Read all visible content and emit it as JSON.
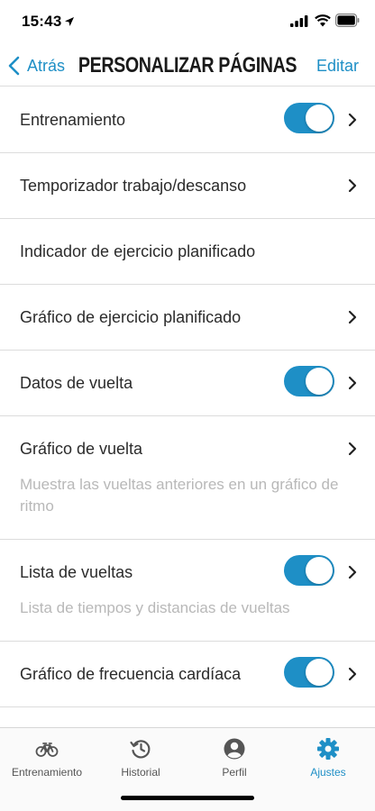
{
  "status_bar": {
    "time": "15:43"
  },
  "nav": {
    "back_label": "Atrás",
    "title": "PERSONALIZAR PÁGINAS",
    "edit_label": "Editar"
  },
  "rows": [
    {
      "label": "Entrenamiento",
      "toggle": true,
      "chevron": true
    },
    {
      "label": "Temporizador trabajo/descanso",
      "toggle": false,
      "chevron": true
    },
    {
      "label": "Indicador de ejercicio planificado",
      "toggle": false,
      "chevron": false
    },
    {
      "label": "Gráfico de ejercicio planificado",
      "toggle": false,
      "chevron": true
    },
    {
      "label": "Datos de vuelta",
      "toggle": true,
      "chevron": true
    },
    {
      "label": "Gráfico de vuelta",
      "toggle": false,
      "chevron": true,
      "description": "Muestra las vueltas anteriores en un gráfico de ritmo"
    },
    {
      "label": "Lista de vueltas",
      "toggle": true,
      "chevron": true,
      "description": "Lista de tiempos y distancias de vueltas"
    },
    {
      "label": "Gráfico de frecuencia cardíaca",
      "toggle": true,
      "chevron": true
    }
  ],
  "tab_bar": {
    "tabs": [
      {
        "label": "Entrenamiento",
        "icon": "bike-icon",
        "active": false
      },
      {
        "label": "Historial",
        "icon": "history-icon",
        "active": false
      },
      {
        "label": "Perfil",
        "icon": "profile-icon",
        "active": false
      },
      {
        "label": "Ajustes",
        "icon": "gear-icon",
        "active": true
      }
    ]
  },
  "colors": {
    "accent": "#1e8fc6",
    "toggle_on": "#1e8fc6",
    "description_text": "#b8b8b8"
  }
}
